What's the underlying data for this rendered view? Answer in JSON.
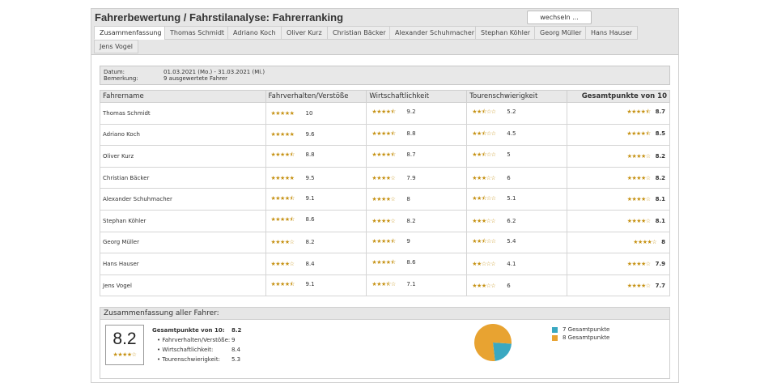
{
  "header": {
    "title": "Fahrerbewertung / Fahrstilanalyse: Fahrerranking",
    "switch_label": "wechseln ..."
  },
  "tabs": [
    {
      "label": "Zusammenfassung",
      "active": true
    },
    {
      "label": "Thomas Schmidt"
    },
    {
      "label": "Adriano Koch"
    },
    {
      "label": "Oliver Kurz"
    },
    {
      "label": "Christian Bäcker"
    },
    {
      "label": "Alexander Schuhmacher"
    },
    {
      "label": "Stephan Köhler"
    },
    {
      "label": "Georg Müller"
    },
    {
      "label": "Hans Hauser"
    },
    {
      "label": "Jens Vogel"
    }
  ],
  "info": {
    "date_label": "Datum:",
    "date_value": "01.03.2021 (Mo.) - 31.03.2021 (Mi.)",
    "note_label": "Bemerkung:",
    "note_value": "9 ausgewertete Fahrer"
  },
  "table": {
    "headers": [
      "Fahrername",
      "Fahrverhalten/Verstöße",
      "Wirtschaftlichkeit",
      "Tourenschwierigkeit",
      "Gesamtpunkte von 10"
    ],
    "rows": [
      {
        "name": "Thomas Schmidt",
        "fahrverhalten": "10",
        "wirtschaft": "9.2",
        "touren": "5.2",
        "gesamt": "8.7"
      },
      {
        "name": "Adriano Koch",
        "fahrverhalten": "9.6",
        "wirtschaft": "8.8",
        "touren": "4.5",
        "gesamt": "8.5"
      },
      {
        "name": "Oliver Kurz",
        "fahrverhalten": "8.8",
        "wirtschaft": "8.7",
        "touren": "5",
        "gesamt": "8.2"
      },
      {
        "name": "Christian Bäcker",
        "fahrverhalten": "9.5",
        "wirtschaft": "7.9",
        "touren": "6",
        "gesamt": "8.2"
      },
      {
        "name": "Alexander Schuhmacher",
        "fahrverhalten": "9.1",
        "wirtschaft": "8",
        "touren": "5.1",
        "gesamt": "8.1"
      },
      {
        "name": "Stephan Köhler",
        "fahrverhalten": "8.6",
        "wirtschaft": "8.2",
        "touren": "6.2",
        "gesamt": "8.1"
      },
      {
        "name": "Georg Müller",
        "fahrverhalten": "8.2",
        "wirtschaft": "9",
        "touren": "5.4",
        "gesamt": "8"
      },
      {
        "name": "Hans Hauser",
        "fahrverhalten": "8.4",
        "wirtschaft": "8.6",
        "touren": "4.1",
        "gesamt": "7.9"
      },
      {
        "name": "Jens Vogel",
        "fahrverhalten": "9.1",
        "wirtschaft": "7.1",
        "touren": "6",
        "gesamt": "7.7"
      }
    ]
  },
  "summary": {
    "title": "Zusammenfassung aller Fahrer:",
    "score": "8.2",
    "total_label": "Gesamtpunkte von 10:",
    "total_value": "8.2",
    "items": [
      {
        "label": "• Fahrverhalten/Verstöße:",
        "value": "9"
      },
      {
        "label": "• Wirtschaftlichkeit:",
        "value": "8.4"
      },
      {
        "label": "• Tourenschwierigkeit:",
        "value": "5.3"
      }
    ],
    "legend": [
      {
        "label": "7 Gesamtpunkte",
        "color": "#3aa8c1",
        "count": 2
      },
      {
        "label": "8 Gesamtpunkte",
        "color": "#e8a331",
        "count": 7
      }
    ]
  },
  "colors": {
    "star": "#c69214"
  }
}
